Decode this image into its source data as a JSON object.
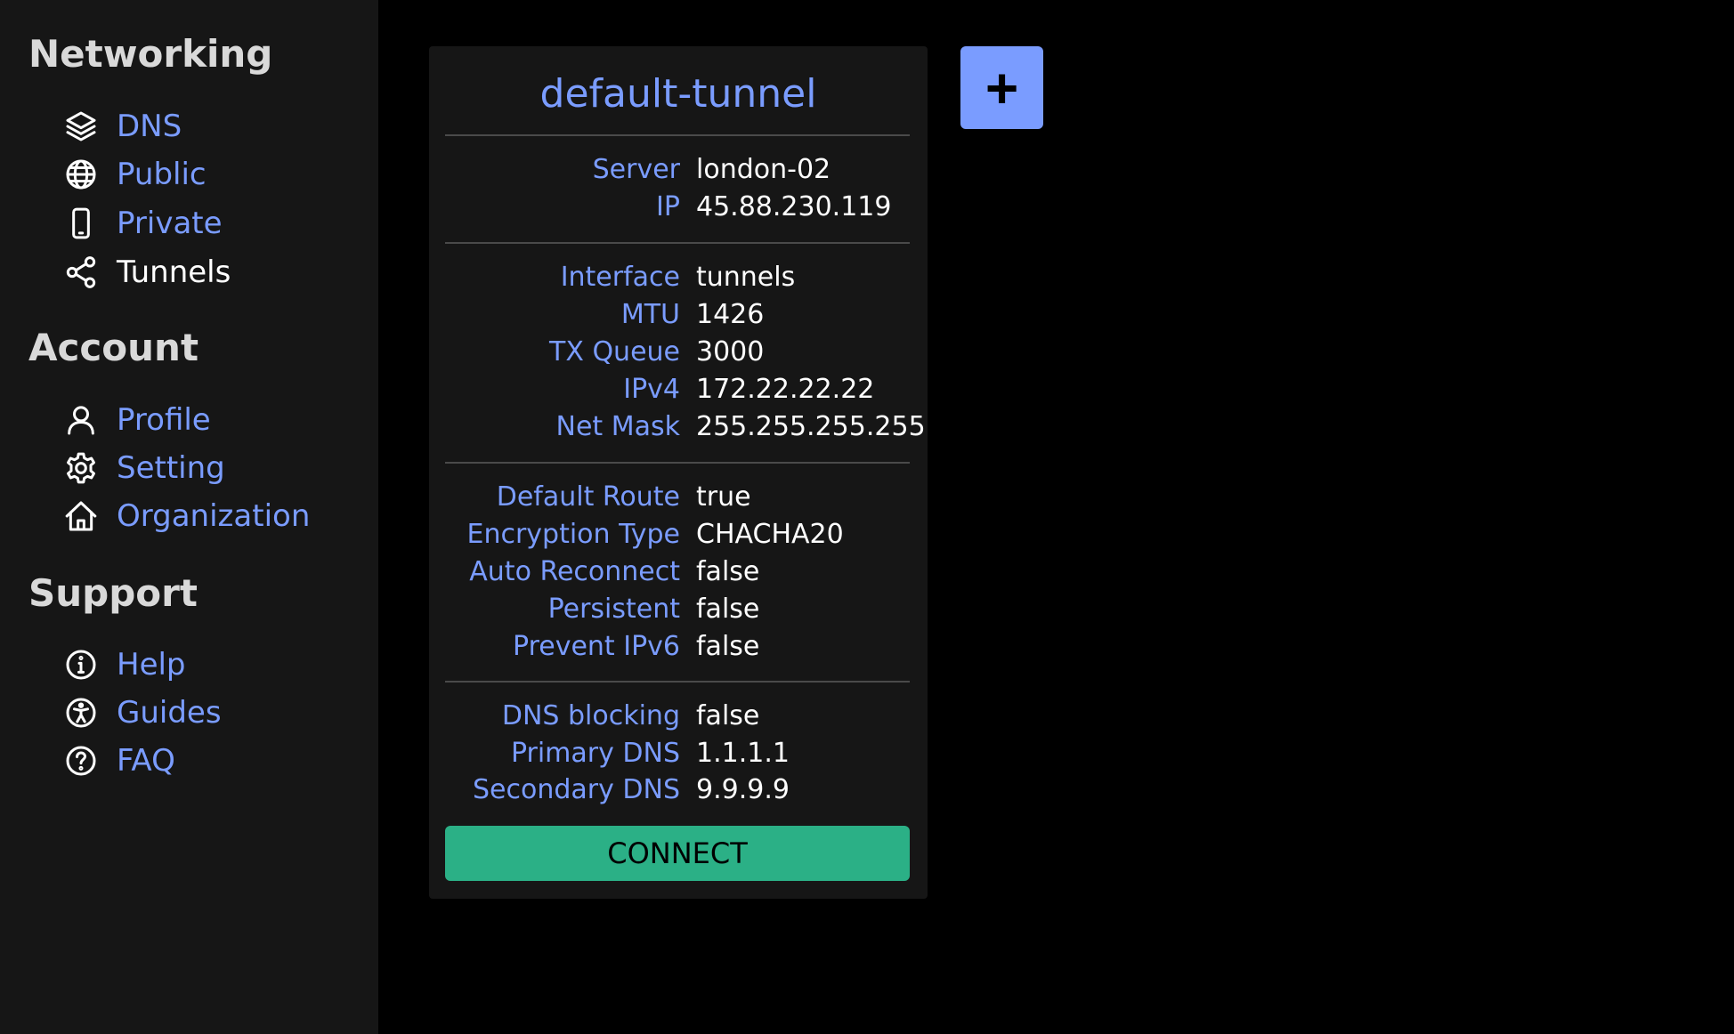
{
  "sidebar": {
    "sections": [
      {
        "title": "Networking",
        "items": [
          {
            "label": "DNS",
            "icon": "layers-icon"
          },
          {
            "label": "Public",
            "icon": "globe-icon"
          },
          {
            "label": "Private",
            "icon": "phone-icon"
          },
          {
            "label": "Tunnels",
            "icon": "share-icon",
            "active": true
          }
        ]
      },
      {
        "title": "Account",
        "items": [
          {
            "label": "Profile",
            "icon": "user-icon"
          },
          {
            "label": "Setting",
            "icon": "gear-icon"
          },
          {
            "label": "Organization",
            "icon": "house-icon"
          }
        ]
      },
      {
        "title": "Support",
        "items": [
          {
            "label": "Help",
            "icon": "info-icon"
          },
          {
            "label": "Guides",
            "icon": "accessibility-icon"
          },
          {
            "label": "FAQ",
            "icon": "question-icon"
          }
        ]
      }
    ]
  },
  "tunnel_card": {
    "title": "default-tunnel",
    "groups": [
      [
        {
          "key": "Server",
          "value": "london-02"
        },
        {
          "key": "IP",
          "value": "45.88.230.119"
        }
      ],
      [
        {
          "key": "Interface",
          "value": "tunnels"
        },
        {
          "key": "MTU",
          "value": "1426"
        },
        {
          "key": "TX Queue",
          "value": "3000"
        },
        {
          "key": "IPv4",
          "value": "172.22.22.22"
        },
        {
          "key": "Net Mask",
          "value": "255.255.255.255"
        }
      ],
      [
        {
          "key": "Default Route",
          "value": "true"
        },
        {
          "key": "Encryption Type",
          "value": "CHACHA20"
        },
        {
          "key": "Auto Reconnect",
          "value": "false"
        },
        {
          "key": "Persistent",
          "value": "false"
        },
        {
          "key": "Prevent IPv6",
          "value": "false"
        }
      ],
      [
        {
          "key": "DNS blocking",
          "value": "false"
        },
        {
          "key": "Primary DNS",
          "value": "1.1.1.1"
        },
        {
          "key": "Secondary DNS",
          "value": "9.9.9.9"
        }
      ]
    ],
    "connect_label": "CONNECT"
  },
  "add_button": {
    "label": "+"
  },
  "colors": {
    "accent": "#7a9cff",
    "connect": "#2bb086",
    "sidebar_bg": "#161616",
    "page_bg": "#000000"
  }
}
